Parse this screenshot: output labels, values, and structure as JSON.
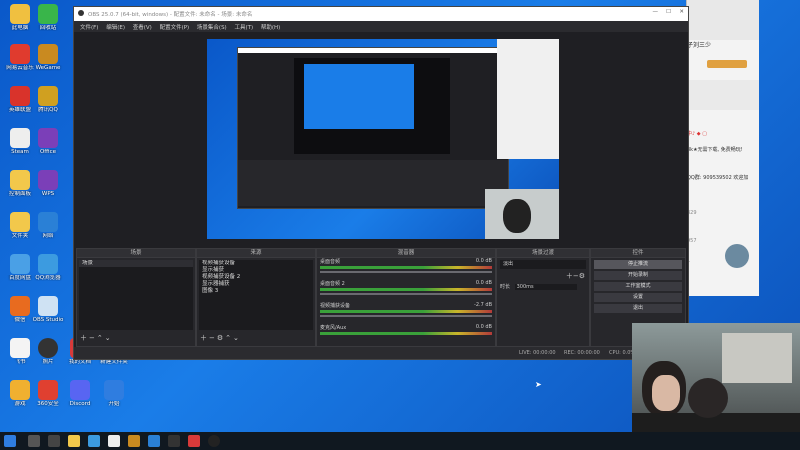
{
  "obs": {
    "title": "OBS 25.0.7 (64-bit, windows) - 配置文件: 未命名 - 场景: 未命名",
    "menu": [
      "文件(F)",
      "编辑(E)",
      "查看(V)",
      "配置文件(P)",
      "场景集合(S)",
      "工具(T)",
      "帮助(H)"
    ],
    "docks": {
      "scenes": {
        "title": "场景",
        "items": [
          "场景"
        ]
      },
      "sources": {
        "title": "来源",
        "items": [
          "视频捕获设备",
          "显示捕获",
          "视频捕获设备 2",
          "显示器捕获",
          "图像 3"
        ]
      },
      "mixer": {
        "title": "混音器",
        "channels": [
          {
            "name": "桌面音频",
            "db": "0.0 dB"
          },
          {
            "name": "桌面音频 2",
            "db": "0.0 dB"
          },
          {
            "name": "视频捕获设备",
            "db": "-2.7 dB"
          },
          {
            "name": "麦克风/Aux",
            "db": "0.0 dB"
          }
        ]
      },
      "transitions": {
        "title": "场景过渡",
        "type": "淡出",
        "duration_label": "时长",
        "duration": "300ms"
      },
      "controls": {
        "title": "控件",
        "buttons": [
          "停止推流",
          "开始录制",
          "工作室模式",
          "设置",
          "退出"
        ]
      }
    },
    "status": {
      "live": "LIVE: 00:00:00",
      "rec": "REC: 00:00:00",
      "cpu": "CPU: 0.0%"
    }
  },
  "chat": {
    "header": "子刘三少",
    "lines": [
      "中♪ ◆ ▢",
      "3k★无需下载, 免费畅玩!",
      "QQ群: 909539502 欢迎加",
      "329",
      "957",
      "1"
    ]
  },
  "desktop_icons": [
    {
      "label": "此电脑"
    },
    {
      "label": "回收站"
    },
    {
      "label": "网易云音乐"
    },
    {
      "label": "WeGame"
    },
    {
      "label": "英雄联盟"
    },
    {
      "label": "腾讯QQ"
    },
    {
      "label": "Steam"
    },
    {
      "label": "Office"
    },
    {
      "label": "控制面板"
    },
    {
      "label": "WPS"
    },
    {
      "label": "文件夹"
    },
    {
      "label": "网络"
    },
    {
      "label": "百度网盘"
    },
    {
      "label": "QQ浏览器"
    },
    {
      "label": "微信"
    },
    {
      "label": "OBS Studio"
    },
    {
      "label": "飞书"
    },
    {
      "label": "照片"
    },
    {
      "label": "我的文档"
    },
    {
      "label": "新建文件夹"
    },
    {
      "label": "游戏"
    },
    {
      "label": "360安全"
    },
    {
      "label": "Discord"
    },
    {
      "label": "开始"
    }
  ],
  "colors": {
    "accent": "#1a7de8",
    "obs_bg": "#1f1f23",
    "taskbar": "#101820"
  }
}
